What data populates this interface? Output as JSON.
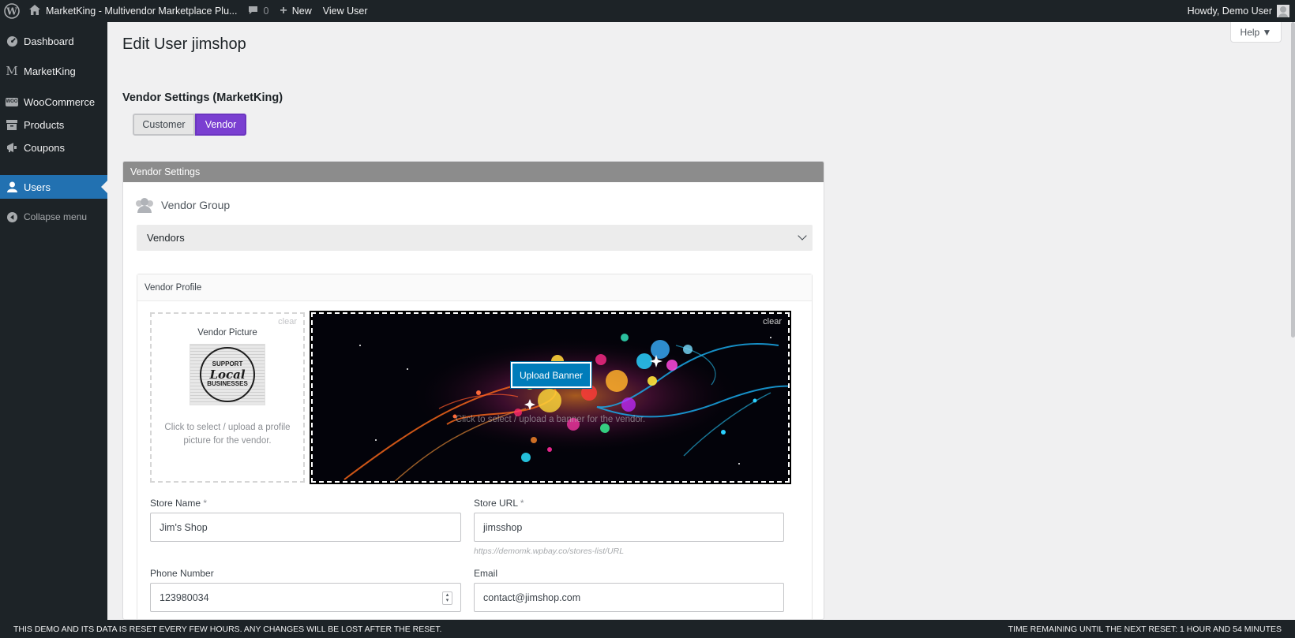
{
  "adminbar": {
    "site_title": "MarketKing - Multivendor Marketplace Plu...",
    "comments_count": "0",
    "new_label": "New",
    "view_user_label": "View User",
    "howdy_label": "Howdy, Demo User"
  },
  "sidebar": {
    "items": [
      {
        "label": "Dashboard",
        "icon": "dashboard-icon"
      },
      {
        "label": "MarketKing",
        "icon": "marketking-icon"
      },
      {
        "label": "WooCommerce",
        "icon": "woocommerce-icon"
      },
      {
        "label": "Products",
        "icon": "products-icon"
      },
      {
        "label": "Coupons",
        "icon": "coupons-icon"
      },
      {
        "label": "Users",
        "icon": "users-icon",
        "active": true
      },
      {
        "label": "Collapse menu",
        "icon": "collapse-icon"
      }
    ],
    "woo_badge": "WOO"
  },
  "help": {
    "label": "Help ▼"
  },
  "page": {
    "title": "Edit User jimshop",
    "section_title": "Vendor Settings (MarketKing)"
  },
  "role_toggle": {
    "options": [
      "Customer",
      "Vendor"
    ],
    "selected": "Vendor"
  },
  "vendor_settings": {
    "header": "Vendor Settings",
    "group_label": "Vendor Group",
    "group_value": "Vendors",
    "profile_header": "Vendor Profile",
    "picture": {
      "clear": "clear",
      "title": "Vendor Picture",
      "image_text_top": "SUPPORT",
      "image_text_mid": "Local",
      "image_text_bottom": "BUSINESSES",
      "help": "Click to select / upload a profile picture for the vendor."
    },
    "banner": {
      "clear": "clear",
      "upload_label": "Upload Banner",
      "help": "Click to select / upload a banner for the vendor."
    },
    "fields": {
      "store_name_label": "Store Name",
      "store_name_value": "Jim's Shop",
      "store_url_label": "Store URL",
      "store_url_value": "jimsshop",
      "store_url_hint": "https://demomk.wpbay.co/stores-list/URL",
      "phone_label": "Phone Number",
      "phone_value": "123980034",
      "email_label": "Email",
      "email_value": "contact@jimshop.com",
      "required_mark": "*"
    }
  },
  "notice": {
    "left": "THIS DEMO AND ITS DATA IS RESET EVERY FEW HOURS. ANY CHANGES WILL BE LOST AFTER THE RESET.",
    "right": "TIME REMAINING UNTIL THE NEXT RESET: 1 HOUR AND 54 MINUTES"
  },
  "colors": {
    "admin_dark": "#1d2327",
    "active_blue": "#2271b1",
    "vendor_purple": "#7a3fd1",
    "upload_blue": "#007cba",
    "panel_header_gray": "#8c8c8c"
  }
}
